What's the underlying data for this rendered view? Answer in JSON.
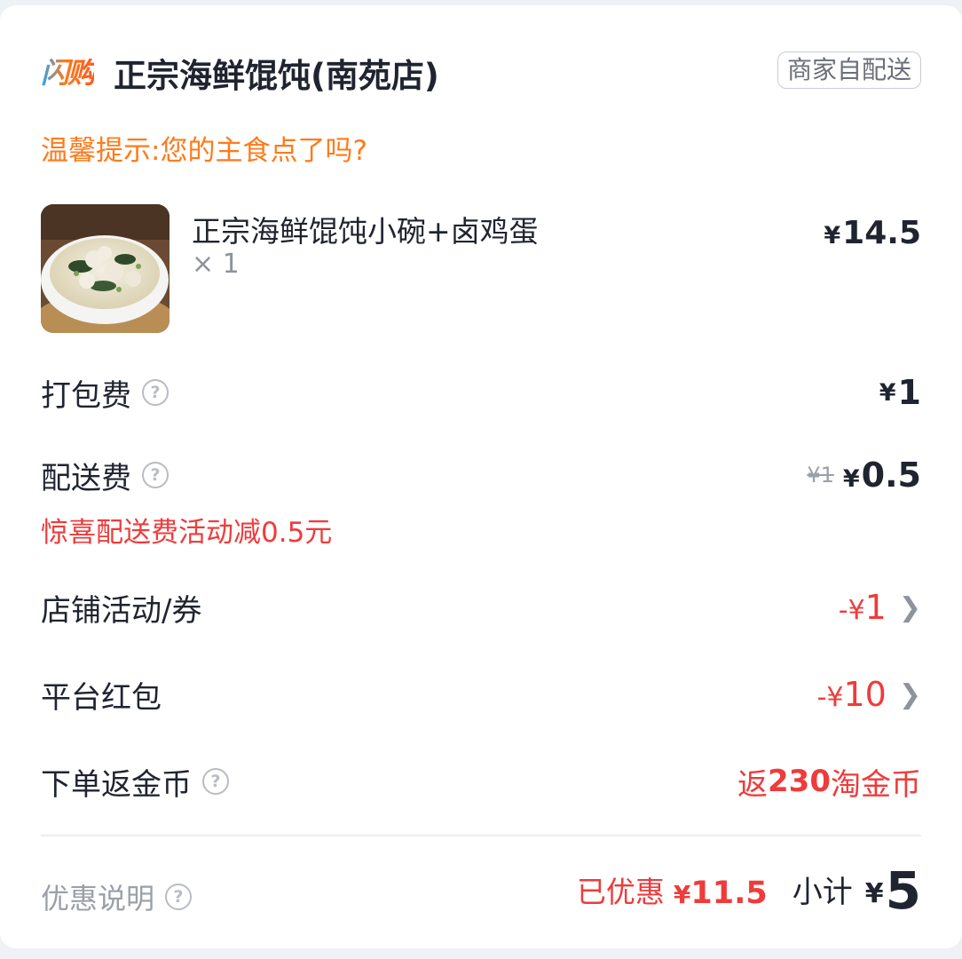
{
  "header": {
    "brand": "闪购",
    "shop_name": "正宗海鲜馄饨(南苑店)",
    "delivery_tag": "商家自配送"
  },
  "tip": "温馨提示:您的主食点了吗?",
  "item": {
    "name": "正宗海鲜馄饨小碗+卤鸡蛋",
    "qty": "× 1",
    "currency": "¥",
    "price": "14.5"
  },
  "packaging": {
    "label": "打包费",
    "currency": "¥",
    "value": "1"
  },
  "delivery": {
    "label": "配送费",
    "old_price": "¥1",
    "currency": "¥",
    "value": "0.5",
    "promo": "惊喜配送费活动减0.5元"
  },
  "store_coupon": {
    "label": "店铺活动/券",
    "prefix": "-¥",
    "value": "1"
  },
  "platform_redpacket": {
    "label": "平台红包",
    "prefix": "-¥",
    "value": "10"
  },
  "gold_coins": {
    "label": "下单返金币",
    "prefix": "返",
    "amount": "230",
    "suffix": "淘金币"
  },
  "footer": {
    "discount_info": "优惠说明",
    "saved_label": "已优惠",
    "saved_currency": "¥",
    "saved_amount": "11.5",
    "subtotal_label": "小计",
    "subtotal_currency": "¥",
    "subtotal_amount": "5"
  },
  "colors": {
    "accent_orange": "#ff7a1a",
    "discount_red": "#ef3b3b",
    "text_dark": "#1f2430",
    "text_muted": "#9aa0a8"
  }
}
